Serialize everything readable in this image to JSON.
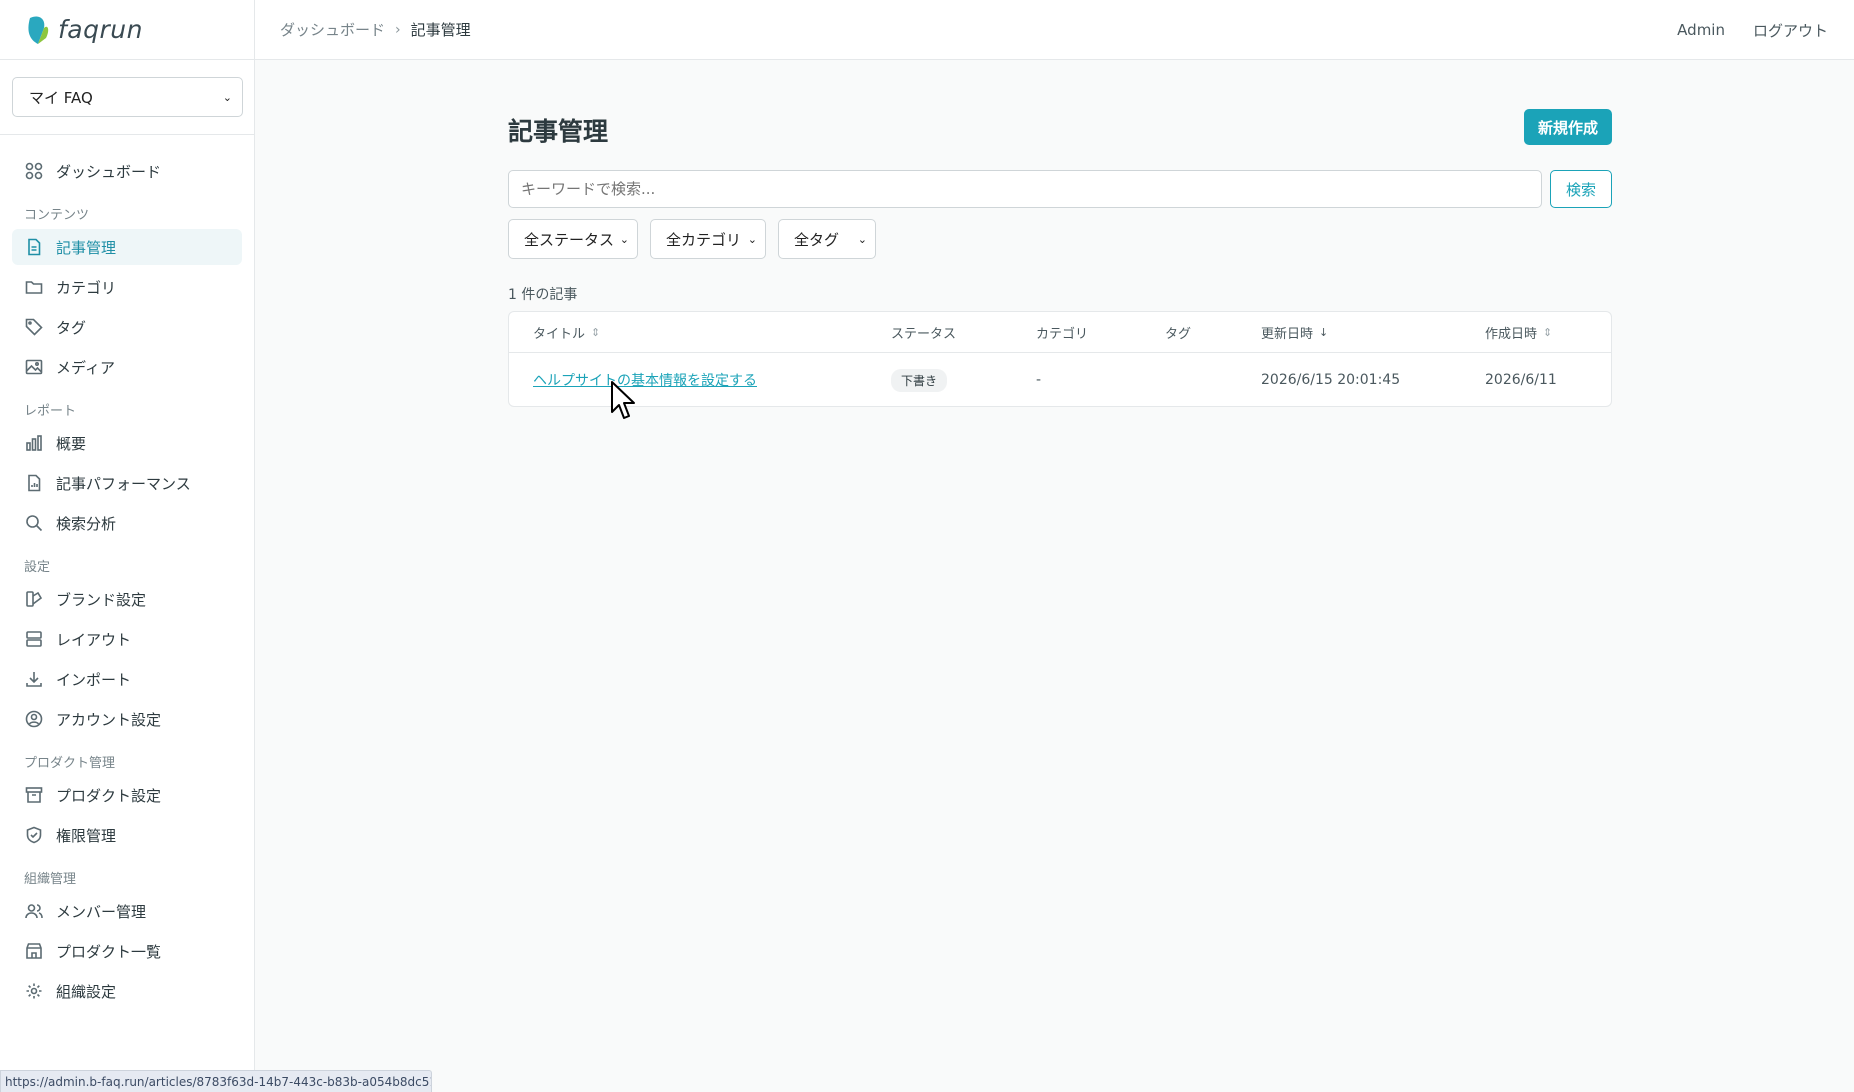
{
  "brand": {
    "name": "faqrun",
    "accent": "#1ba3b8"
  },
  "sidebar": {
    "product_select": "マイ FAQ",
    "dashboard": "ダッシュボード",
    "sections": {
      "content": "コンテンツ",
      "reports": "レポート",
      "settings": "設定",
      "product_mgmt": "プロダクト管理",
      "org_mgmt": "組織管理"
    },
    "items": {
      "articles": "記事管理",
      "categories": "カテゴリ",
      "tags": "タグ",
      "media": "メディア",
      "overview": "概要",
      "article_performance": "記事パフォーマンス",
      "search_analysis": "検索分析",
      "brand_settings": "ブランド設定",
      "layout": "レイアウト",
      "import": "インポート",
      "account_settings": "アカウント設定",
      "product_settings": "プロダクト設定",
      "permissions": "権限管理",
      "members": "メンバー管理",
      "product_list": "プロダクト一覧",
      "org_settings": "組織設定"
    }
  },
  "topbar": {
    "breadcrumb_root": "ダッシュボード",
    "breadcrumb_current": "記事管理",
    "user": "Admin",
    "logout": "ログアウト"
  },
  "main": {
    "title": "記事管理",
    "new_button": "新規作成",
    "search_placeholder": "キーワードで検索...",
    "search_button": "検索",
    "filters": {
      "status": "全ステータス",
      "category": "全カテゴリ",
      "tag": "全タグ"
    },
    "count": "1 件の記事",
    "columns": {
      "title": "タイトル",
      "status": "ステータス",
      "category": "カテゴリ",
      "tag": "タグ",
      "updated": "更新日時",
      "created": "作成日時"
    },
    "rows": [
      {
        "title": "ヘルプサイトの基本情報を設定する",
        "status": "下書き",
        "category": "-",
        "tag": "",
        "updated": "2026/6/15 20:01:45",
        "created": "2026/6/11"
      }
    ]
  },
  "statusbar": {
    "url": "https://admin.b-faq.run/articles/8783f63d-14b7-443c-b83b-a054b8dc5181/edit"
  }
}
